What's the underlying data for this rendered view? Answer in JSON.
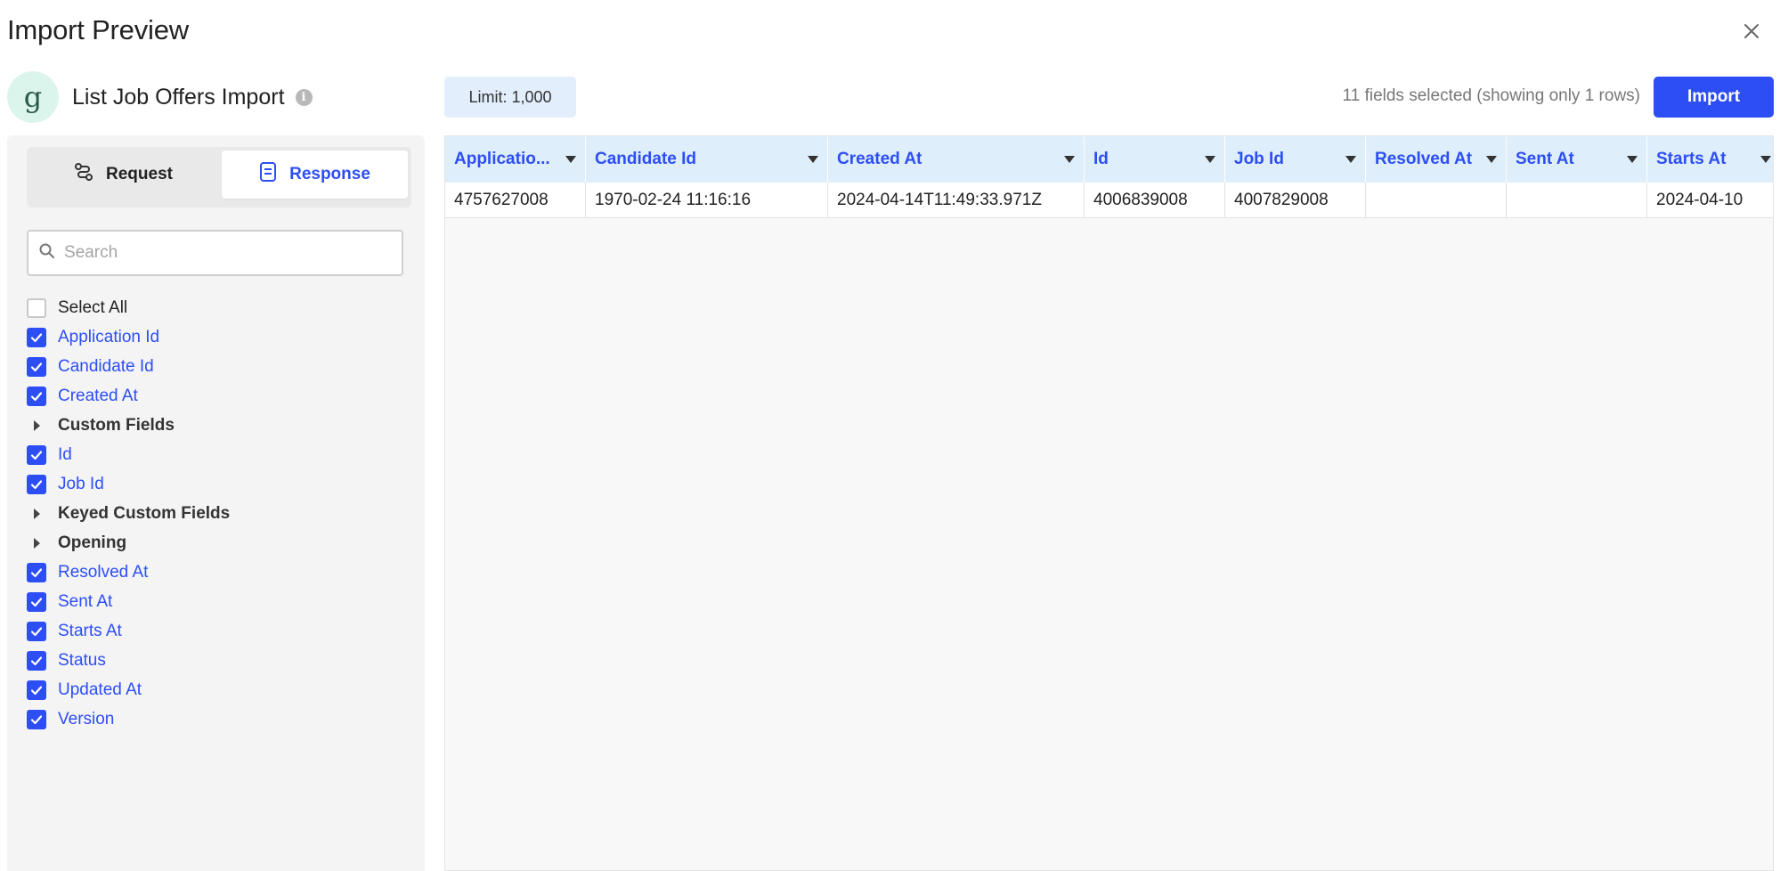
{
  "dialog": {
    "title": "Import Preview"
  },
  "source": {
    "name": "List Job Offers Import",
    "logo_glyph": "g",
    "info_glyph": "i"
  },
  "toolbar": {
    "limit_label": "Limit: 1,000",
    "fields_info": "11 fields selected (showing only 1 rows)",
    "import_label": "Import"
  },
  "tabs": {
    "request": "Request",
    "response": "Response",
    "active": "response"
  },
  "search": {
    "placeholder": "Search",
    "value": ""
  },
  "fields": [
    {
      "label": "Select All",
      "type": "checkbox",
      "checked": false
    },
    {
      "label": "Application Id",
      "type": "checkbox",
      "checked": true
    },
    {
      "label": "Candidate Id",
      "type": "checkbox",
      "checked": true
    },
    {
      "label": "Created At",
      "type": "checkbox",
      "checked": true
    },
    {
      "label": "Custom Fields",
      "type": "group"
    },
    {
      "label": "Id",
      "type": "checkbox",
      "checked": true
    },
    {
      "label": "Job Id",
      "type": "checkbox",
      "checked": true
    },
    {
      "label": "Keyed Custom Fields",
      "type": "group"
    },
    {
      "label": "Opening",
      "type": "group"
    },
    {
      "label": "Resolved At",
      "type": "checkbox",
      "checked": true
    },
    {
      "label": "Sent At",
      "type": "checkbox",
      "checked": true
    },
    {
      "label": "Starts At",
      "type": "checkbox",
      "checked": true
    },
    {
      "label": "Status",
      "type": "checkbox",
      "checked": true
    },
    {
      "label": "Updated At",
      "type": "checkbox",
      "checked": true
    },
    {
      "label": "Version",
      "type": "checkbox",
      "checked": true
    }
  ],
  "table": {
    "columns": [
      "Applicatio...",
      "Candidate Id",
      "Created At",
      "Id",
      "Job Id",
      "Resolved At",
      "Sent At",
      "Starts At"
    ],
    "rows": [
      [
        "4757627008",
        "1970-02-24 11:16:16",
        "2024-04-14T11:49:33.971Z",
        "4006839008",
        "4007829008",
        "",
        "",
        "2024-04-10"
      ]
    ]
  },
  "colors": {
    "accent": "#2d4ef5",
    "header_bg": "#deeefb",
    "limit_bg": "#e2eefb",
    "logo_bg": "#dcf5ec"
  }
}
